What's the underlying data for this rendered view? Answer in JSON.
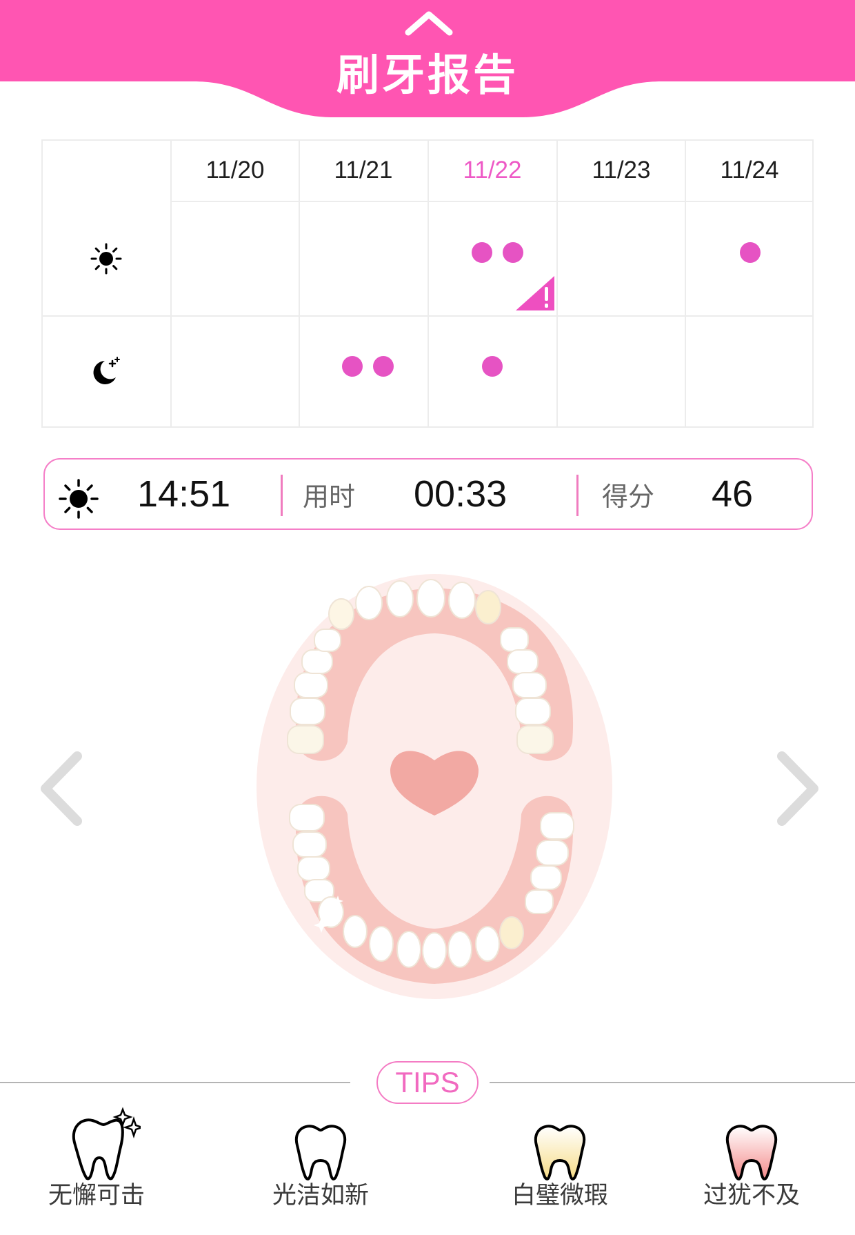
{
  "header": {
    "title": "刷牙报告",
    "collapse_icon": "chevron-up-icon",
    "color": "#ff55b2"
  },
  "calendar": {
    "dates": [
      "11/20",
      "11/21",
      "11/22",
      "11/23",
      "11/24"
    ],
    "active_date": "11/22",
    "rows": [
      {
        "icon": "sun-icon",
        "counts": [
          0,
          0,
          2,
          0,
          1
        ],
        "warning": [
          false,
          false,
          true,
          false,
          false
        ]
      },
      {
        "icon": "moon-icon",
        "counts": [
          0,
          2,
          1,
          0,
          0
        ],
        "warning": [
          false,
          false,
          false,
          false,
          false
        ]
      }
    ],
    "dot_color": "#e653c3",
    "warning_icon": "warning-icon"
  },
  "session": {
    "period_icon": "sun-icon",
    "time": "14:51",
    "duration_label": "用时",
    "duration": "00:33",
    "score_label": "得分",
    "score": "46"
  },
  "navigation": {
    "prev_icon": "chevron-left-icon",
    "next_icon": "chevron-right-icon"
  },
  "tips": {
    "badge": "TIPS",
    "items": [
      {
        "label": "无懈可击",
        "icon": "sparkling-tooth-icon",
        "color": "#ffffff"
      },
      {
        "label": "光洁如新",
        "icon": "clean-tooth-icon",
        "color": "#ffffff"
      },
      {
        "label": "白璧微瑕",
        "icon": "yellow-tooth-icon",
        "color": "#fbe8a8"
      },
      {
        "label": "过犹不及",
        "icon": "red-tooth-icon",
        "color": "#f7a3a3"
      }
    ]
  }
}
